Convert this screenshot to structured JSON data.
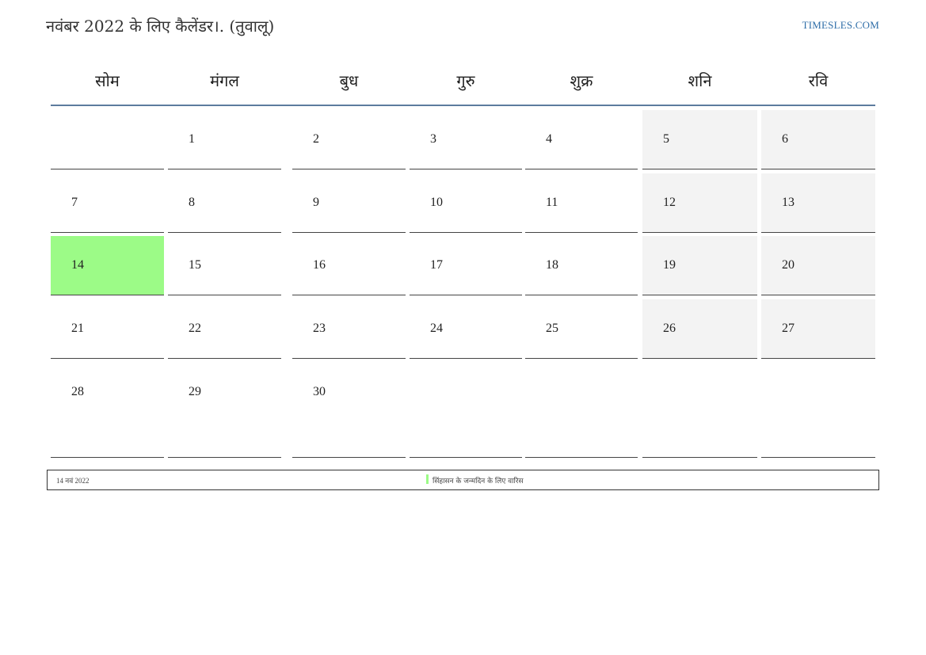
{
  "header": {
    "title": "नवंबर 2022 के लिए कैलेंडर।. (तुवालू)",
    "site": "TIMESLES.COM"
  },
  "weekdays": [
    "सोम",
    "मंगल",
    "बुध",
    "गुरु",
    "शुक्र",
    "शनि",
    "रवि"
  ],
  "weeks": [
    [
      "",
      "1",
      "2",
      "3",
      "4",
      "5",
      "6"
    ],
    [
      "7",
      "8",
      "9",
      "10",
      "11",
      "12",
      "13"
    ],
    [
      "14",
      "15",
      "16",
      "17",
      "18",
      "19",
      "20"
    ],
    [
      "21",
      "22",
      "23",
      "24",
      "25",
      "26",
      "27"
    ],
    [
      "28",
      "29",
      "30",
      "",
      "",
      "",
      ""
    ]
  ],
  "highlighted_day": "14",
  "weekend_columns": [
    5,
    6
  ],
  "colors": {
    "highlight": "#9cfb87",
    "weekend": "#f3f3f3",
    "accent_line": "#5d7b9e",
    "link": "#2f6ea8"
  },
  "legend": {
    "date": "14 नवं  2022",
    "event": "सिंहासन के जन्मदिन के लिए वारिस"
  }
}
